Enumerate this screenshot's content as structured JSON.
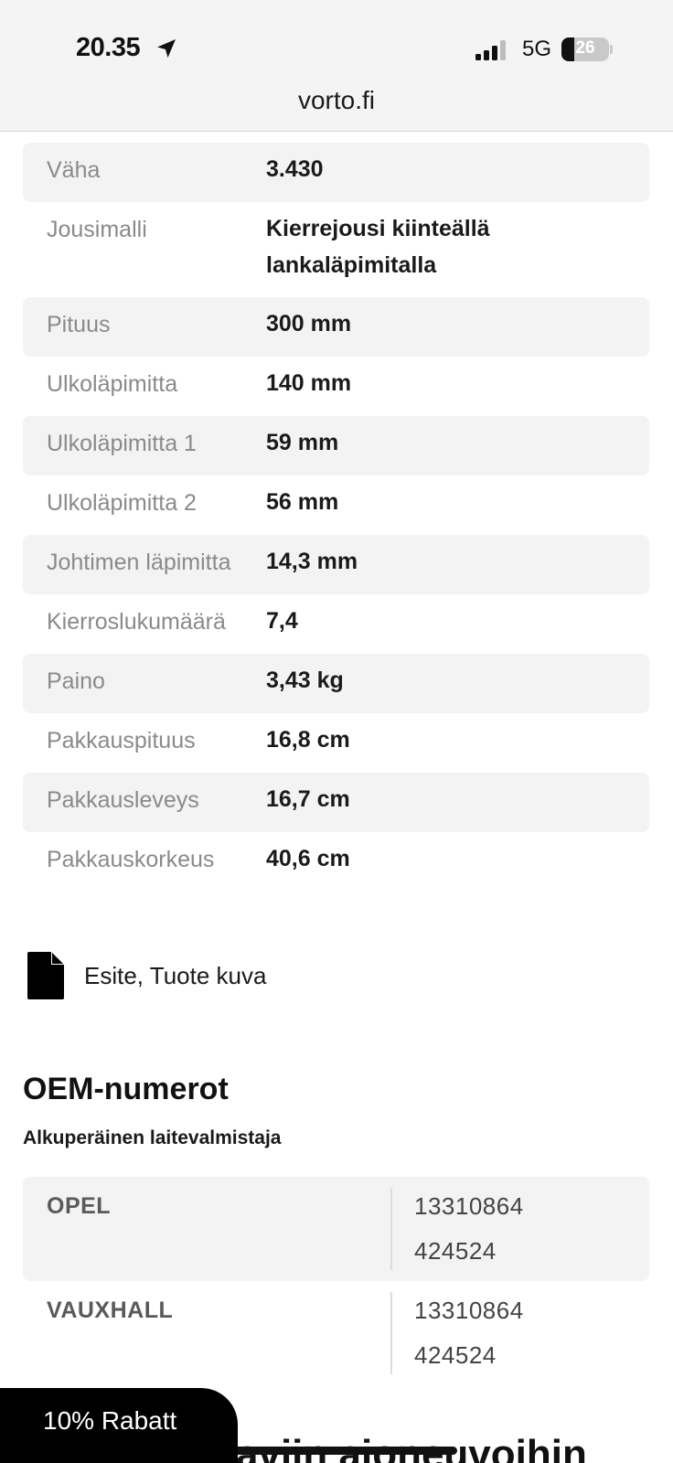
{
  "status_bar": {
    "time": "20.35",
    "location_icon": "location-arrow-icon",
    "signal_icon": "cellular-signal-icon",
    "network": "5G",
    "battery": "26",
    "battery_level": 0.26
  },
  "browser": {
    "url": "vorto.fi"
  },
  "specs": [
    {
      "label": "Väha",
      "value": "3.430"
    },
    {
      "label": "Jousimalli",
      "value": "Kierrejousi kiinteällä lankaläpimitalla"
    },
    {
      "label": "Pituus",
      "value": "300 mm"
    },
    {
      "label": "Ulkoläpimitta",
      "value": "140 mm"
    },
    {
      "label": "Ulkoläpimitta 1",
      "value": "59 mm"
    },
    {
      "label": "Ulkoläpimitta 2",
      "value": "56 mm"
    },
    {
      "label": "Johtimen läpimitta",
      "value": "14,3 mm"
    },
    {
      "label": "Kierroslukumäärä",
      "value": "7,4"
    },
    {
      "label": "Paino",
      "value": "3,43 kg"
    },
    {
      "label": "Pakkauspituus",
      "value": "16,8 cm"
    },
    {
      "label": "Pakkausleveys",
      "value": "16,7 cm"
    },
    {
      "label": "Pakkauskorkeus",
      "value": "40,6 cm"
    }
  ],
  "documents": {
    "icon": "document-icon",
    "label": "Esite, Tuote kuva"
  },
  "oem": {
    "title": "OEM-numerot",
    "subtitle": "Alkuperäinen laitevalmistaja",
    "rows": [
      {
        "brand": "OPEL",
        "numbers": [
          "13310864",
          "424524"
        ]
      },
      {
        "brand": "VAUXHALL",
        "numbers": [
          "13310864",
          "424524"
        ]
      }
    ]
  },
  "next_section": {
    "heading_fragment": "aviin ajoneuvoihin"
  },
  "discount_button": {
    "label": "10% Rabatt"
  }
}
